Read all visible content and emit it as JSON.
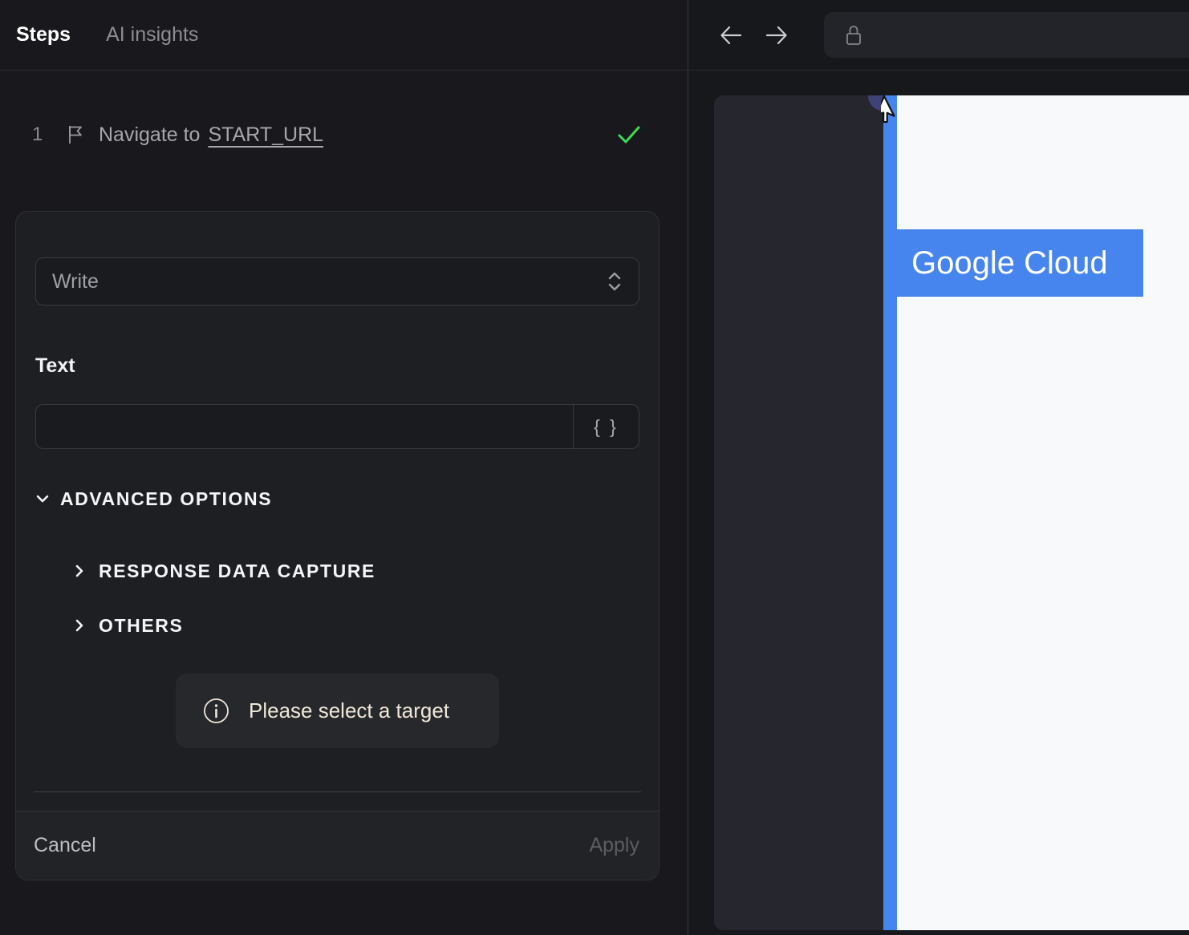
{
  "left_panel": {
    "tabs": [
      {
        "label": "Steps",
        "active": true
      },
      {
        "label": "AI insights",
        "active": false
      }
    ],
    "step": {
      "number": "1",
      "label": "Navigate to",
      "target": "START_URL",
      "status": "success"
    },
    "form": {
      "action_value": "Write",
      "text_label": "Text",
      "text_value": "",
      "variable_button_label": "{ }",
      "advanced_label": "ADVANCED OPTIONS",
      "sections": [
        {
          "label": "RESPONSE DATA CAPTURE"
        },
        {
          "label": "OTHERS"
        }
      ],
      "hint": "Please select a target",
      "cancel_label": "Cancel",
      "apply_label": "Apply"
    }
  },
  "browser": {
    "url_value": "",
    "page": {
      "highlight_label": "Google Cloud"
    }
  },
  "icons": {
    "flag-icon": "⚐",
    "check-icon": "✓",
    "select-updown-icon": "⌃⌄",
    "chevron-down-icon": "⌄",
    "chevron-right-icon": "›",
    "info-icon": "ⓘ",
    "back-arrow-icon": "←",
    "forward-arrow-icon": "→",
    "lock-icon": "lock",
    "mouse-cursor-icon": "↖",
    "variable-braces-icon": "{ }"
  },
  "colors": {
    "accent_blue": "#4785ee",
    "success_green": "#3edb52",
    "hint_text": "#efe8d8",
    "page_white": "#f8f9fa",
    "click_dot": "#3e4277"
  }
}
